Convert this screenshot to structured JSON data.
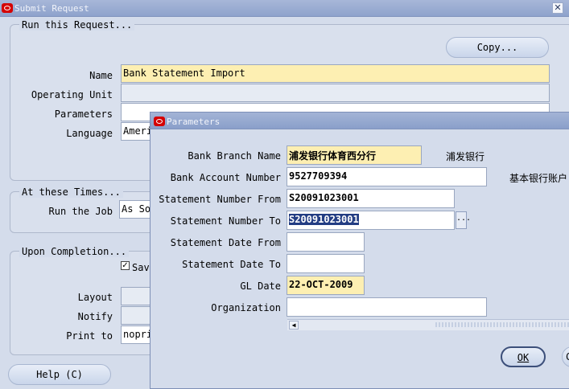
{
  "window": {
    "title": "Submit Request",
    "close_glyph": "✕"
  },
  "run_request": {
    "legend": "Run this Request...",
    "copy_button": "Copy...",
    "name_label": "Name",
    "name_value": "Bank Statement Import",
    "operating_unit_label": "Operating Unit",
    "operating_unit_value": "",
    "parameters_label": "Parameters",
    "parameters_value": "",
    "language_label": "Language",
    "language_value": "Ameri"
  },
  "at_times": {
    "legend": "At these Times...",
    "run_job_label": "Run the Job",
    "run_job_value": "As So"
  },
  "completion": {
    "legend": "Upon Completion...",
    "save_checkbox_label": "Sav",
    "save_checked": true,
    "layout_label": "Layout",
    "notify_label": "Notify",
    "print_to_label": "Print to",
    "print_to_value": "nopri"
  },
  "help_button": "Help (C)",
  "parameters_dialog": {
    "title": "Parameters",
    "fields": {
      "bank_branch_name": {
        "label": "Bank Branch Name",
        "value": "浦发银行体育西分行",
        "desc": "浦发银行"
      },
      "bank_account_number": {
        "label": "Bank Account Number",
        "value": "9527709394",
        "desc": "基本银行账户"
      },
      "statement_number_from": {
        "label": "Statement Number From",
        "value": "S20091023001"
      },
      "statement_number_to": {
        "label": "Statement Number To",
        "value": "S20091023001"
      },
      "statement_date_from": {
        "label": "Statement Date From",
        "value": ""
      },
      "statement_date_to": {
        "label": "Statement Date To",
        "value": ""
      },
      "gl_date": {
        "label": "GL Date",
        "value": "22-OCT-2009"
      },
      "organization": {
        "label": "Organization",
        "value": ""
      }
    },
    "lov_glyph": "...",
    "ok_button": "OK",
    "cancel_button_partial": "C"
  }
}
